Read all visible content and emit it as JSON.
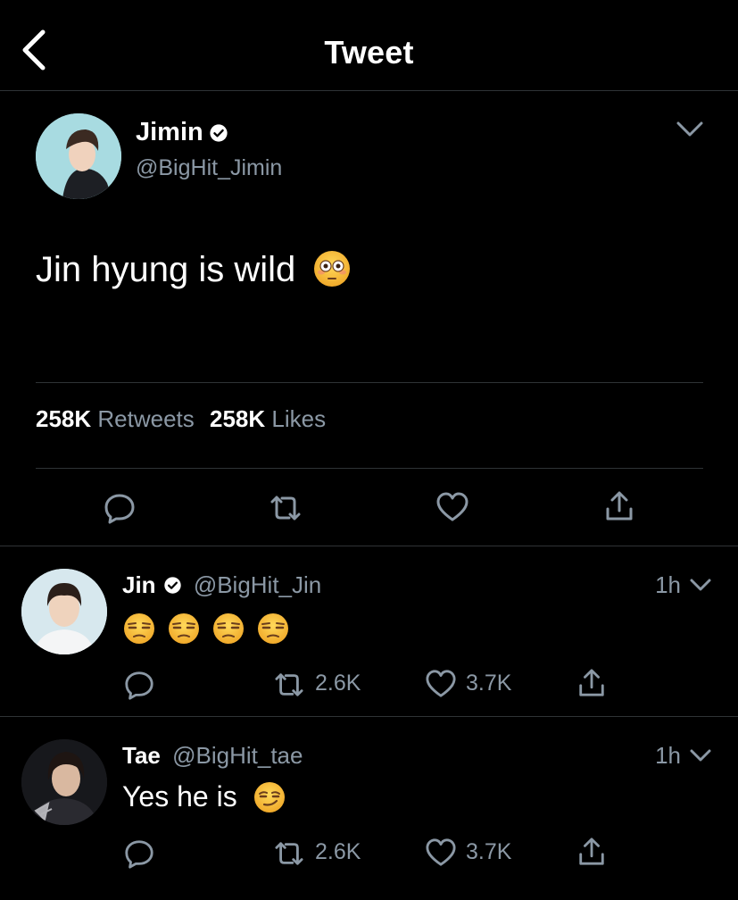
{
  "header": {
    "title": "Tweet"
  },
  "tweet": {
    "author": {
      "name": "Jimin",
      "handle": "@BigHit_Jimin"
    },
    "text": "Jin hyung is wild",
    "emoji": "flushed-face",
    "stats": {
      "retweets_count": "258K",
      "retweets_label": "Retweets",
      "likes_count": "258K",
      "likes_label": "Likes"
    }
  },
  "replies": [
    {
      "author": {
        "name": "Jin",
        "handle": "@BigHit_Jin",
        "verified": true
      },
      "time": "1h",
      "text": "",
      "emoji": "unamused-face x4",
      "retweets": "2.6K",
      "likes": "3.7K"
    },
    {
      "author": {
        "name": "Tae",
        "handle": "@BigHit_tae",
        "verified": false
      },
      "time": "1h",
      "text": "Yes he is",
      "emoji": "smirking-face",
      "retweets": "2.6K",
      "likes": "3.7K"
    }
  ],
  "colors": {
    "background": "#000000",
    "secondary_text": "#8b98a5",
    "divider": "#2f3336",
    "emoji_yellow": "#f7c33d"
  }
}
